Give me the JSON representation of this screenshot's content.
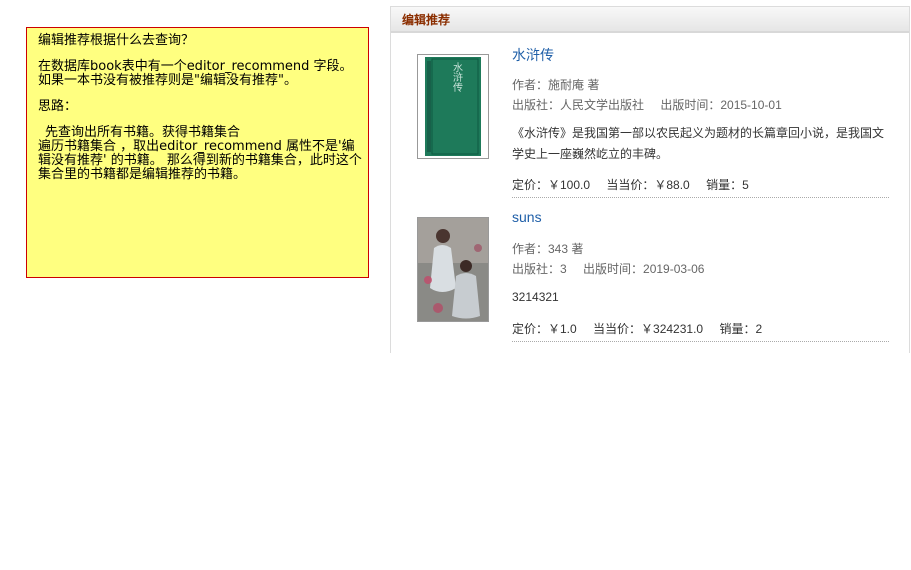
{
  "note": {
    "question": "编辑推荐根据什么去查询？",
    "explanation": "在数据库book表中有一个editor_recommend 字段。如果一本书没有被推荐则是\"编辑没有推荐\"。",
    "thinking_label": "思路：",
    "thinking_body": "先查询出所有书籍。获得书籍集合\n遍历书籍集合 ，取出editor_recommend 属性不是'编辑没有推荐' 的书籍。 那么得到新的书籍集合，此时这个集合里的书籍都是编辑推荐的书籍。"
  },
  "panel": {
    "title": "编辑推荐",
    "books": [
      {
        "name": "水浒传",
        "author": "作者：施耐庵 著",
        "publisher": "出版社：人民文学出版社",
        "pub_date": "出版时间：2015-10-01",
        "description": "《水浒传》是我国第一部以农民起义为题材的长篇章回小说，是我国文学史上一座巍然屹立的丰碑。",
        "list_price": "定价：￥100.0",
        "current_price": "当当价：￥88.0",
        "sales": "销量：5",
        "cover_title": "水浒传",
        "cover_color": "#1e7a5a"
      },
      {
        "name": "suns",
        "author": "作者：343 著",
        "publisher": "出版社：3",
        "pub_date": "出版时间：2019-03-06",
        "description": "3214321",
        "list_price": "定价：￥1.0",
        "current_price": "当当价：￥324231.0",
        "sales": "销量：2",
        "cover_color": "#8a8a86"
      }
    ]
  }
}
